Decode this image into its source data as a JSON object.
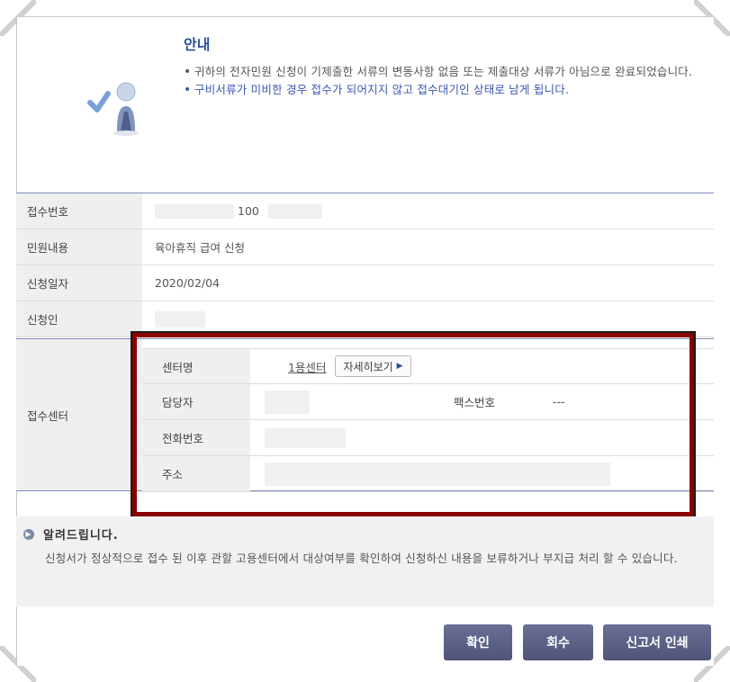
{
  "guide": {
    "title": "안내",
    "bullet1": "귀하의 전자민원 신청이 기제출한 서류의 변동사항 없음 또는 제출대상 서류가 아님으로 완료되었습니다.",
    "bullet2": "구비서류가 미비한 경우 접수가 되어지지 않고 접수대기인 상태로 남게 됩니다.",
    "icon": "checkmark-person-icon"
  },
  "info": {
    "rows": [
      {
        "label": "접수번호",
        "value": "100"
      },
      {
        "label": "민원내용",
        "value": "육아휴직 급여 신청"
      },
      {
        "label": "신청일자",
        "value": "2020/02/04"
      },
      {
        "label": "신청인",
        "value": ""
      }
    ]
  },
  "center": {
    "label": "접수센터",
    "name_label": "센터명",
    "name_value": "1용센터",
    "detail_button": "자세히보기",
    "manager_label": "담당자",
    "fax_label": "팩스번호",
    "fax_value": "---",
    "phone_label": "전화번호",
    "address_label": "주소"
  },
  "notice": {
    "title": "알려드립니다.",
    "text": "신청서가 정상적으로 접수 된 이후 관할 고용센터에서 대상여부를 확인하여 신청하신 내용을 보류하거나 부지급 처리 할 수 있습니다."
  },
  "buttons": {
    "confirm": "확인",
    "withdraw": "회수",
    "print": "신고서 인쇄"
  },
  "colors": {
    "accent_blue": "#2a4f9a",
    "highlight_red": "#8a0000",
    "button_bg": "#5a5f84"
  }
}
